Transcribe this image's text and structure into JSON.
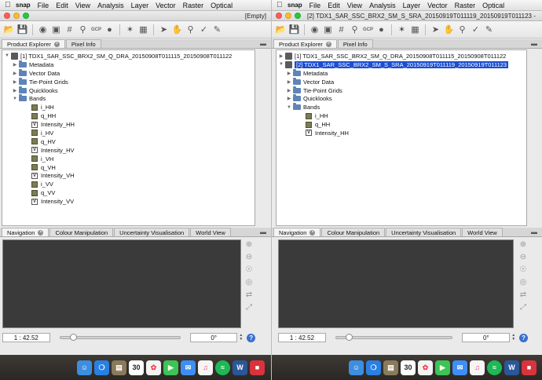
{
  "menubar": {
    "apple": "",
    "app": "snap",
    "items": [
      "File",
      "Edit",
      "View",
      "Analysis",
      "Layer",
      "Vector",
      "Raster",
      "Optical"
    ]
  },
  "left": {
    "window_title": "[Empty]",
    "tabs_top": [
      "Product Explorer",
      "Pixel Info"
    ],
    "tree": [
      {
        "kind": "product",
        "label": "[1] TDX1_SAR_SSC_BRX2_SM_Q_DRA_20150908T011115_20150908T011122",
        "open": true
      },
      {
        "kind": "folder",
        "label": "Metadata"
      },
      {
        "kind": "folder",
        "label": "Vector Data"
      },
      {
        "kind": "folder",
        "label": "Tie-Point Grids"
      },
      {
        "kind": "folder",
        "label": "Quicklooks"
      },
      {
        "kind": "folder-open",
        "label": "Bands"
      },
      {
        "kind": "band",
        "label": "i_HH"
      },
      {
        "kind": "band",
        "label": "q_HH"
      },
      {
        "kind": "vband",
        "label": "Intensity_HH"
      },
      {
        "kind": "band",
        "label": "i_HV"
      },
      {
        "kind": "band",
        "label": "q_HV"
      },
      {
        "kind": "vband",
        "label": "Intensity_HV"
      },
      {
        "kind": "band",
        "label": "i_VH"
      },
      {
        "kind": "band",
        "label": "q_VH"
      },
      {
        "kind": "vband",
        "label": "Intensity_VH"
      },
      {
        "kind": "band",
        "label": "i_VV"
      },
      {
        "kind": "band",
        "label": "q_VV"
      },
      {
        "kind": "vband",
        "label": "Intensity_VV"
      }
    ],
    "tabs_bottom": [
      "Navigation",
      "Colour Manipulation",
      "Uncertainty Visualisation",
      "World View"
    ],
    "scale": "1 : 42.52",
    "angle": "0°"
  },
  "right": {
    "window_title": "[2] TDX1_SAR_SSC_BRX2_SM_S_SRA_20150919T011119_20150919T011123 -",
    "tabs_top": [
      "Product Explorer",
      "Pixel Info"
    ],
    "tree": [
      {
        "kind": "product",
        "label": "[1] TDX1_SAR_SSC_BRX2_SM_Q_DRA_20150908T011115_20150908T011122",
        "open": false
      },
      {
        "kind": "product",
        "label": "[2] TDX1_SAR_SSC_BRX2_SM_S_SRA_20150919T011119_20150919T011123",
        "open": true,
        "selected": true
      },
      {
        "kind": "folder",
        "label": "Metadata"
      },
      {
        "kind": "folder",
        "label": "Vector Data"
      },
      {
        "kind": "folder",
        "label": "Tie-Point Grids"
      },
      {
        "kind": "folder",
        "label": "Quicklooks"
      },
      {
        "kind": "folder-open",
        "label": "Bands"
      },
      {
        "kind": "band",
        "label": "i_HH"
      },
      {
        "kind": "band",
        "label": "q_HH"
      },
      {
        "kind": "vband",
        "label": "Intensity_HH"
      }
    ],
    "tabs_bottom": [
      "Navigation",
      "Colour Manipulation",
      "Uncertainty Visualisation",
      "World View"
    ],
    "scale": "1 : 42.52",
    "angle": "0°"
  },
  "dock": {
    "calendar_day": "30",
    "word_letter": "W"
  },
  "colors": {
    "selection": "#1b4ed1",
    "nav_background": "#3a3a3a",
    "dock": "#2e2a27"
  }
}
